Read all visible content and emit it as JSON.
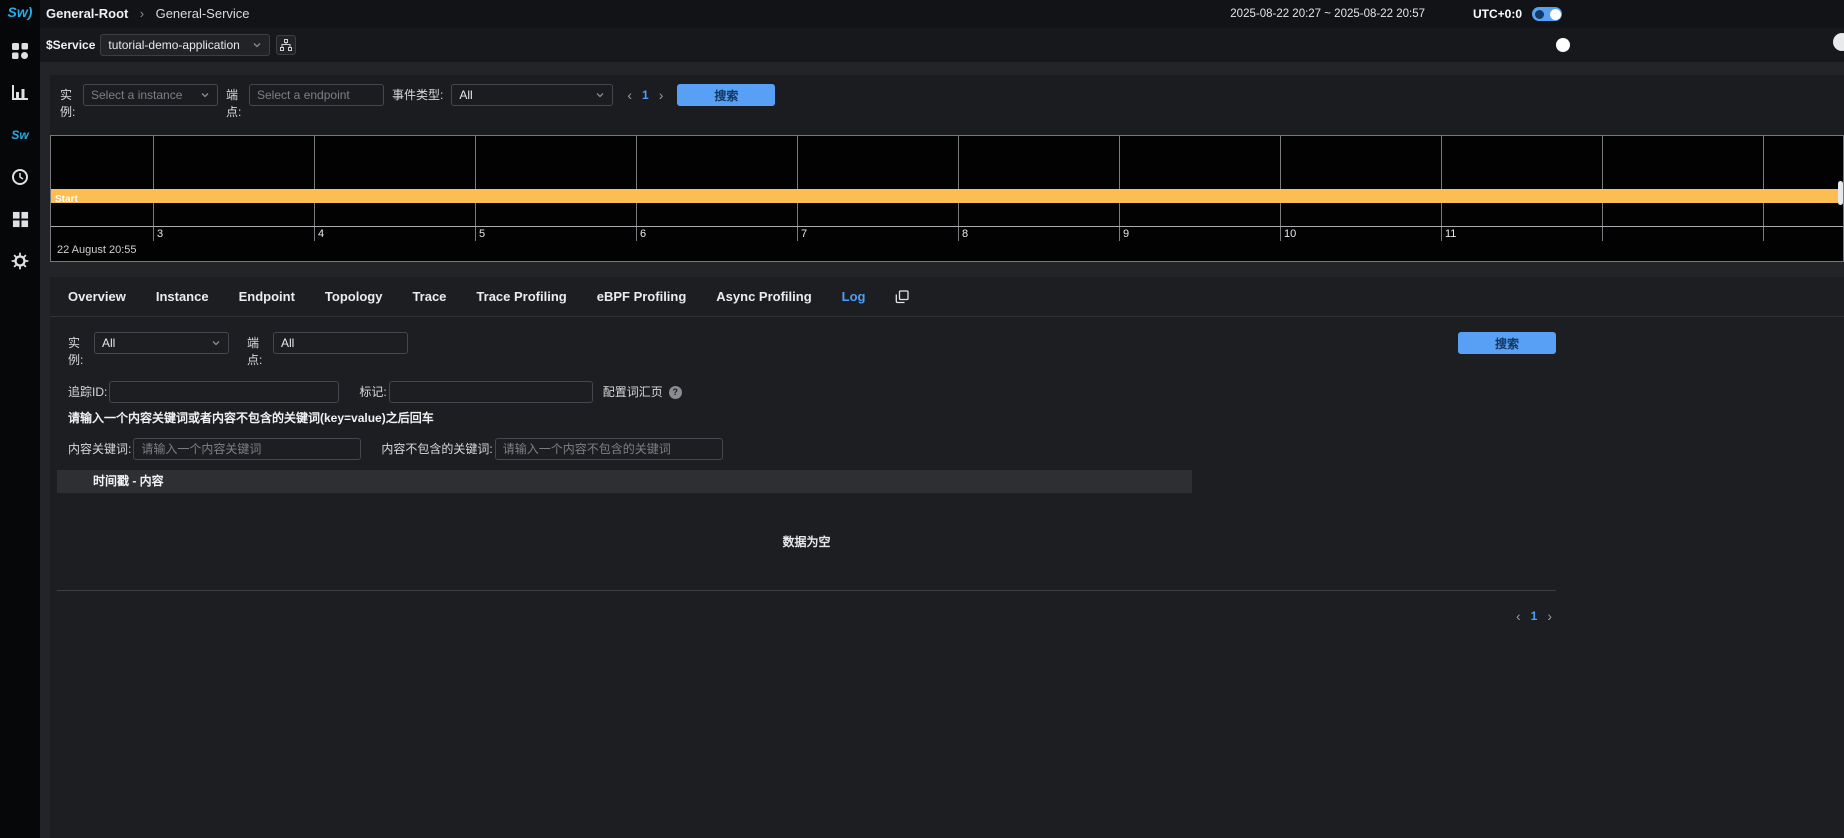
{
  "colors": {
    "accent_blue": "#4a9efc",
    "button_blue": "#57a0f5",
    "timeline_bar_orange": "#fcbd52"
  },
  "sidebar": {
    "logo_text": "Sw",
    "logo_mark": ")",
    "items": [
      {
        "name": "dashboards",
        "icon": "grid-icon"
      },
      {
        "name": "charts",
        "icon": "bar-chart-icon"
      },
      {
        "name": "marketplace",
        "icon": "sw-badge",
        "label": "Sw"
      },
      {
        "name": "alarm",
        "icon": "clock-icon"
      },
      {
        "name": "widgets",
        "icon": "blocks-icon"
      },
      {
        "name": "settings",
        "icon": "gear-icon"
      }
    ]
  },
  "breadcrumb": {
    "root": "General-Root",
    "separator": "›",
    "current": "General-Service"
  },
  "topbar": {
    "time_range": "2025-08-22 20:27 ~ 2025-08-22 20:57",
    "timezone": "UTC+0:0"
  },
  "servicebar": {
    "label": "$Service",
    "selected_service": "tutorial-demo-application"
  },
  "event_search": {
    "instance_label": "实例:",
    "instance_placeholder": "Select a instance",
    "endpoint_label": "端点:",
    "endpoint_placeholder": "Select a endpoint",
    "event_type_label": "事件类型:",
    "event_type_value": "All",
    "pager": {
      "prev": "‹",
      "page": "1",
      "next": "›"
    },
    "search_label": "搜索"
  },
  "timeline": {
    "bar_label": "Start",
    "axis_start_time": "22 August 20:55",
    "tick_labels": [
      "3",
      "4",
      "5",
      "6",
      "7",
      "8",
      "9",
      "10",
      "11",
      "",
      ""
    ]
  },
  "tabs": {
    "labels": [
      "Overview",
      "Instance",
      "Endpoint",
      "Topology",
      "Trace",
      "Trace Profiling",
      "eBPF Profiling",
      "Async Profiling",
      "Log"
    ],
    "active": "Log"
  },
  "log_panel": {
    "instance_label": "实例:",
    "instance_value": "All",
    "endpoint_label": "端点:",
    "endpoint_value": "All",
    "search_label": "搜索",
    "trace_id_label": "追踪ID:",
    "tag_label": "标记:",
    "keywords_link": "配置词汇页",
    "help_mark": "?",
    "hint": "请输入一个内容关键词或者内容不包含的关键词(key=value)之后回车",
    "include_label": "内容关键词:",
    "include_placeholder": "请输入一个内容关键词",
    "exclude_label": "内容不包含的关键词:",
    "exclude_placeholder": "请输入一个内容不包含的关键词",
    "table_header": "时间戳 - 内容",
    "empty_text": "数据为空",
    "pager": {
      "prev": "‹",
      "page": "1",
      "next": "›"
    }
  }
}
